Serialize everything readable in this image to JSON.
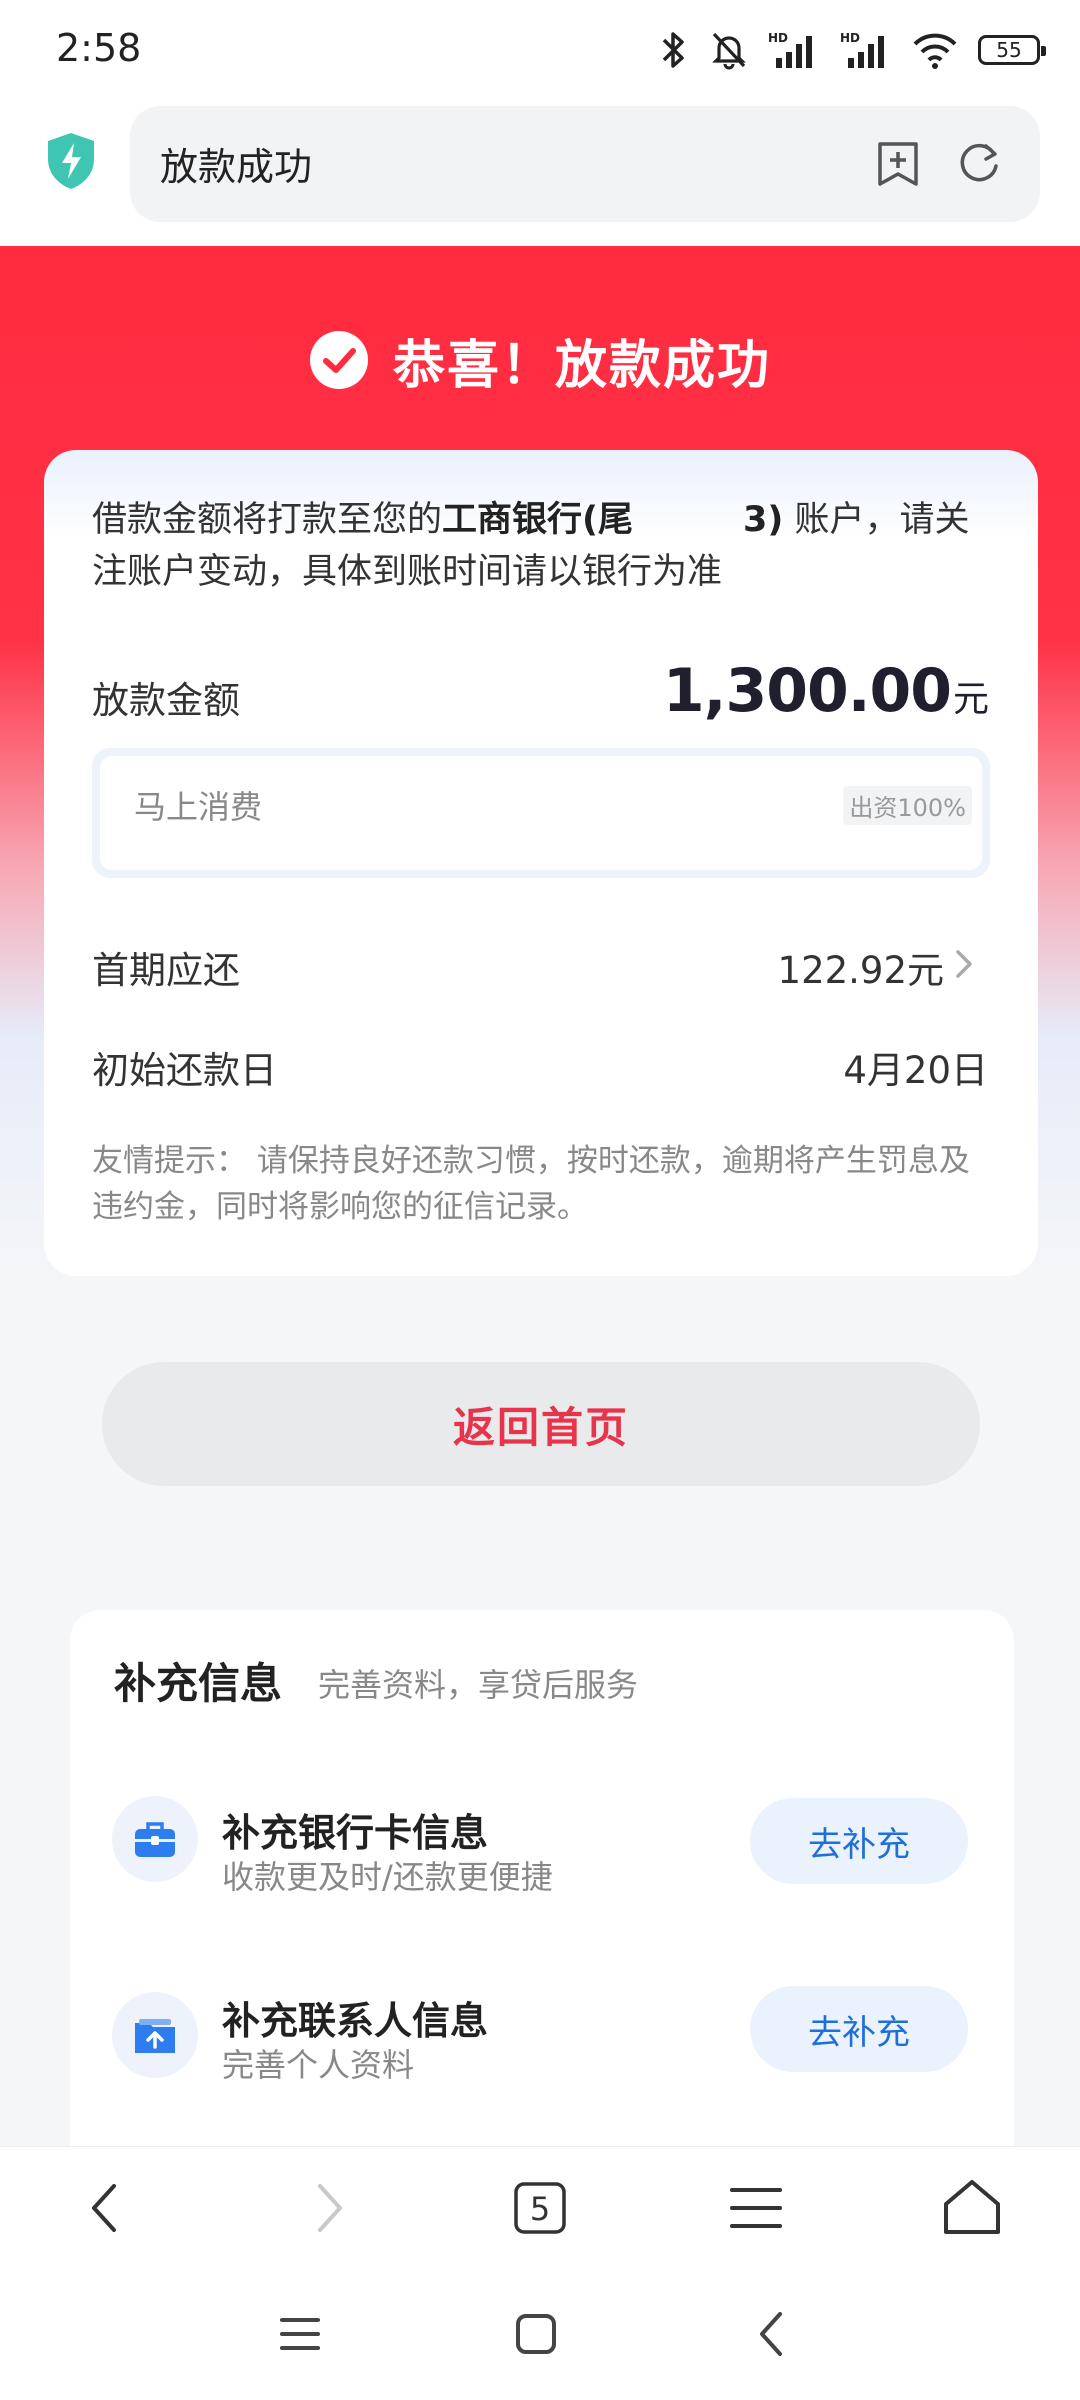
{
  "status_bar": {
    "time": "2:58",
    "battery": "55",
    "hd_label": "HD"
  },
  "browser": {
    "address_text": "放款成功",
    "tab_count": "5"
  },
  "banner": {
    "title": "恭喜！放款成功"
  },
  "card": {
    "notice_pre": "借款金额将打款至您的",
    "notice_bank": "工商银行(尾",
    "notice_tail": "3)",
    "notice_post": " 账户，请关注账户变动，具体到账时间请以银行为准",
    "amount_label": "放款金额",
    "amount_value": "1,300.00",
    "amount_unit": "元",
    "lender_name": "马上消费",
    "lender_share": "出资100%",
    "first_payment_label": "首期应还",
    "first_payment_value": "122.92元",
    "first_date_label": "初始还款日",
    "first_date_value": "4月20日",
    "tip": "友情提示：  请保持良好还款习惯，按时还款，逾期将产生罚息及违约金，同时将影响您的征信记录。"
  },
  "home_button": "返回首页",
  "supplement": {
    "title": "补充信息",
    "subtitle": "完善资料，享贷后服务",
    "items": [
      {
        "title": "补充银行卡信息",
        "desc": "收款更及时/还款更便捷",
        "button": "去补充",
        "icon": "briefcase-icon"
      },
      {
        "title": "补充联系人信息",
        "desc": "完善个人资料",
        "button": "去补充",
        "icon": "folder-upload-icon"
      }
    ]
  },
  "colors": {
    "brand_red": "#ff2b3f",
    "accent_blue": "#1f6fdb",
    "button_text_red": "#e8344a"
  }
}
